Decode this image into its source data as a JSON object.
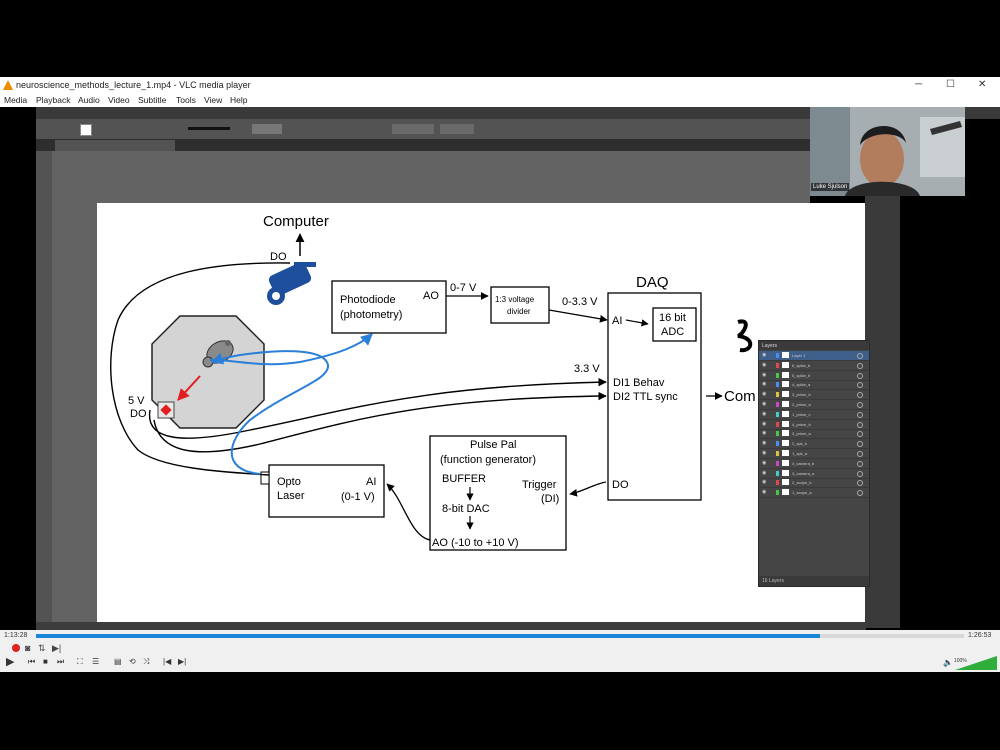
{
  "vlc": {
    "window_title": "neuroscience_methods_lecture_1.mp4 - VLC media player",
    "menu": [
      "Media",
      "Playback",
      "Audio",
      "Video",
      "Subtitle",
      "Tools",
      "View",
      "Help"
    ],
    "time_elapsed": "1:13:28",
    "time_total": "1:26:53",
    "volume_level": "100%",
    "progress_fraction": 0.845
  },
  "webcam": {
    "name": "Luke Sjulson"
  },
  "diagram": {
    "computer": "Computer",
    "do_top": "DO",
    "photodiode_l1": "Photodiode",
    "photodiode_l2": "(photometry)",
    "photodiode_ao": "AO",
    "v07": "0-7 V",
    "divider_l1": "1:3 voltage",
    "divider_l2": "divider",
    "v033": "0-3.3 V",
    "daq": "DAQ",
    "ai": "AI",
    "adc_l1": "16 bit",
    "adc_l2": "ADC",
    "v33": "3.3 V",
    "di1": "DI1 Behav",
    "di2": "DI2 TTL sync",
    "com": "Com",
    "do_daq": "DO",
    "v5": "5 V",
    "do_led": "DO",
    "pp_l1": "Pulse Pal",
    "pp_l2": "(function generator)",
    "buffer": "BUFFER",
    "dac": "8-bit DAC",
    "pp_ao": "AO (-10 to +10 V)",
    "trigger_l1": "Trigger",
    "trigger_l2": "(DI)",
    "opto_l1": "Opto",
    "opto_l2": "Laser",
    "opto_ai": "AI",
    "opto_range": "(0-1 V)"
  },
  "layers_panel": {
    "title": "Layers",
    "footer": "16 Layers",
    "rows": [
      "Layer 1",
      "6_spike_b",
      "5_spike_b",
      "4_spike_a",
      "3_prism_b",
      "2_prism_a",
      "1_prism_c",
      "4_prism_b",
      "3_prism_a",
      "2_spk_b",
      "1_spk_a",
      "4_camera_b",
      "3_camera_a",
      "2_scope_b",
      "1_scope_a"
    ],
    "colors": [
      "#4b8cf0",
      "#e34848",
      "#48c848",
      "#4b8cf0",
      "#e0c040",
      "#c848c8",
      "#48c8c8",
      "#e34848",
      "#48c848",
      "#4b8cf0",
      "#e0c040",
      "#c848c8",
      "#48c8c8",
      "#e34848",
      "#48c848"
    ]
  }
}
